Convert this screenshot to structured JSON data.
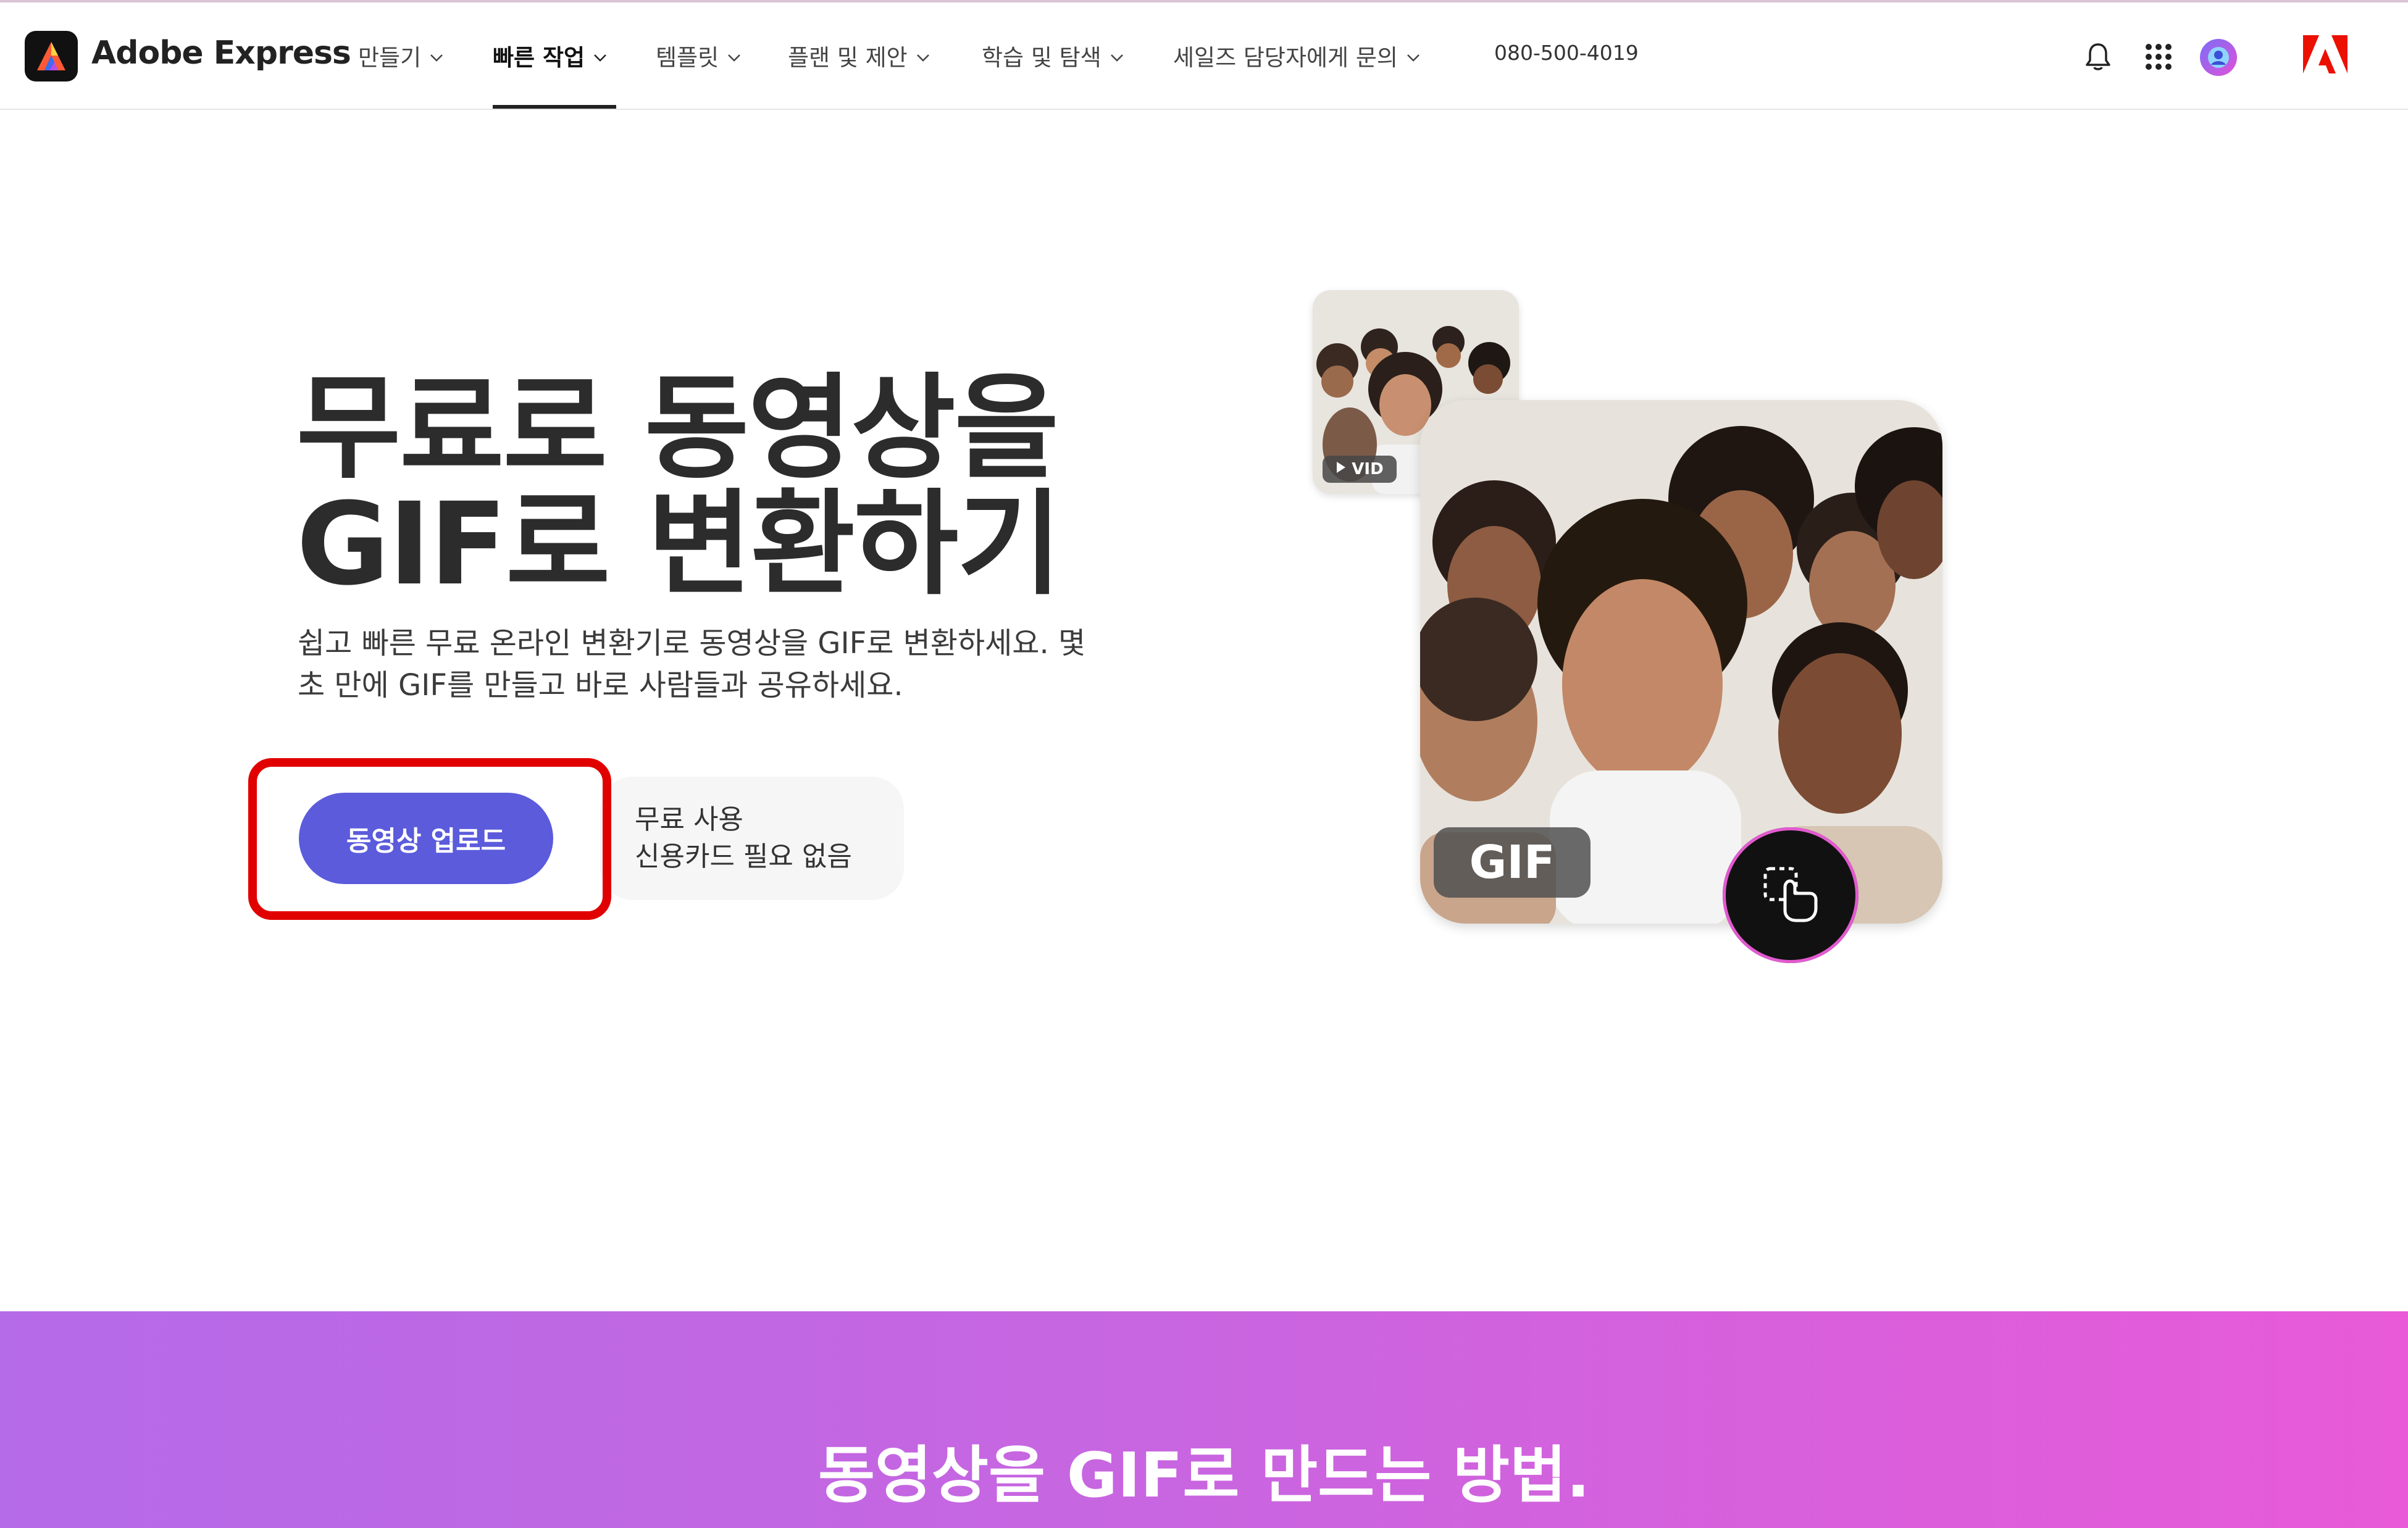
{
  "header": {
    "brand": "Adobe Express",
    "nav": [
      {
        "label": "만들기"
      },
      {
        "label": "빠른 작업"
      },
      {
        "label": "템플릿"
      },
      {
        "label": "플랜 및 제안"
      },
      {
        "label": "학습 및 탐색"
      },
      {
        "label": "세일즈 담당자에게 문의"
      }
    ],
    "active_nav": "빠른 작업",
    "phone": "080-500-4019",
    "icons": [
      "bell-icon",
      "app-grid-icon",
      "avatar",
      "adobe-logo-icon"
    ]
  },
  "hero": {
    "title_line1": "무료로 동영상을",
    "title_line2": "GIF로 변환하기",
    "desc_line1": "쉽고 빠른 무료 온라인 변환기로 동영상을 GIF로 변환하세요. 몇",
    "desc_line2": "초 만에 GIF를 만들고 바로 사람들과 공유하세요.",
    "upload_button": "동영상 업로드",
    "note_line1": "무료 사용",
    "note_line2": "신용카드 필요 없음"
  },
  "media": {
    "vid_badge": "VID",
    "gif_badge": "GIF"
  },
  "section": {
    "title": "동영상을 GIF로 만드는 방법."
  },
  "colors": {
    "accent": "#5b5bdc",
    "highlight": "#e10000",
    "band_start": "#b56ae8",
    "band_end": "#e85ad8"
  }
}
